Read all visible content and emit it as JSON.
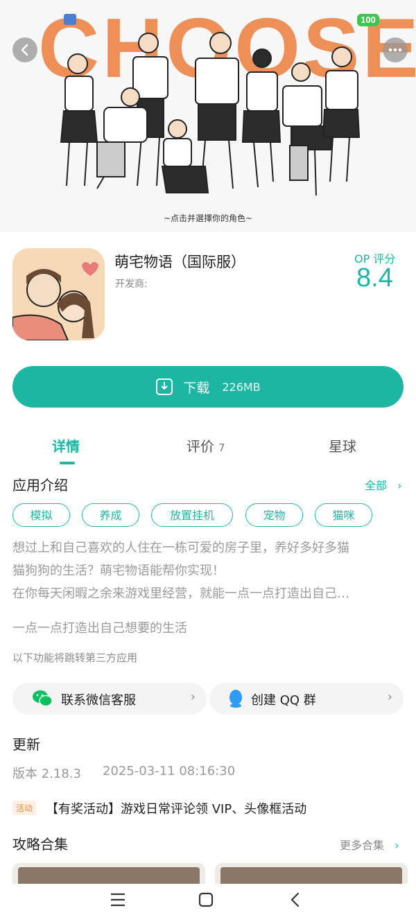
{
  "status_bar": {
    "battery": "100"
  },
  "banner": {
    "title": "CHOOSE",
    "caption": "~点击并選擇你的角色~"
  },
  "nav": {
    "back_icon": "chevron-left-icon",
    "more_icon": "more-dots-icon"
  },
  "app": {
    "name": "萌宅物语（国际服）",
    "developer_label": "开发商:",
    "score_label": "OP 评分",
    "score": "8.4"
  },
  "download": {
    "label": "下载",
    "size": "226MB"
  },
  "tabs": [
    {
      "label": "详情",
      "active": true
    },
    {
      "label": "评价",
      "count": "7"
    },
    {
      "label": "星球"
    }
  ],
  "intro": {
    "title": "应用介绍",
    "all_label": "全部",
    "tags": [
      "模拟",
      "养成",
      "放置挂机",
      "宠物",
      "猫咪"
    ],
    "desc_lines": [
      "想过上和自己喜欢的人住在一栋可爱的房子里，养好多好多猫",
      "猫狗狗的生活？萌宅物语能帮你实现！",
      "在你每天闲暇之余来游戏里经营，就能一点一点打造出自己…"
    ],
    "desc_extra": "一点一点打造出自己想要的生活"
  },
  "third_party": {
    "note": "以下功能将跳转第三方应用",
    "wechat": "联系微信客服",
    "qq": "创建 QQ 群"
  },
  "update": {
    "title": "更新",
    "version": "版本 2.18.3",
    "date": "2025-03-11 08:16:30"
  },
  "event": {
    "tag": "活动",
    "text": "【有奖活动】游戏日常评论领 VIP、头像框活动"
  },
  "guides": {
    "title": "攻略合集",
    "more_label": "更多合集"
  },
  "colors": {
    "accent": "#1db6a3",
    "banner_title": "#ee8f58",
    "battery": "#3fc450"
  }
}
